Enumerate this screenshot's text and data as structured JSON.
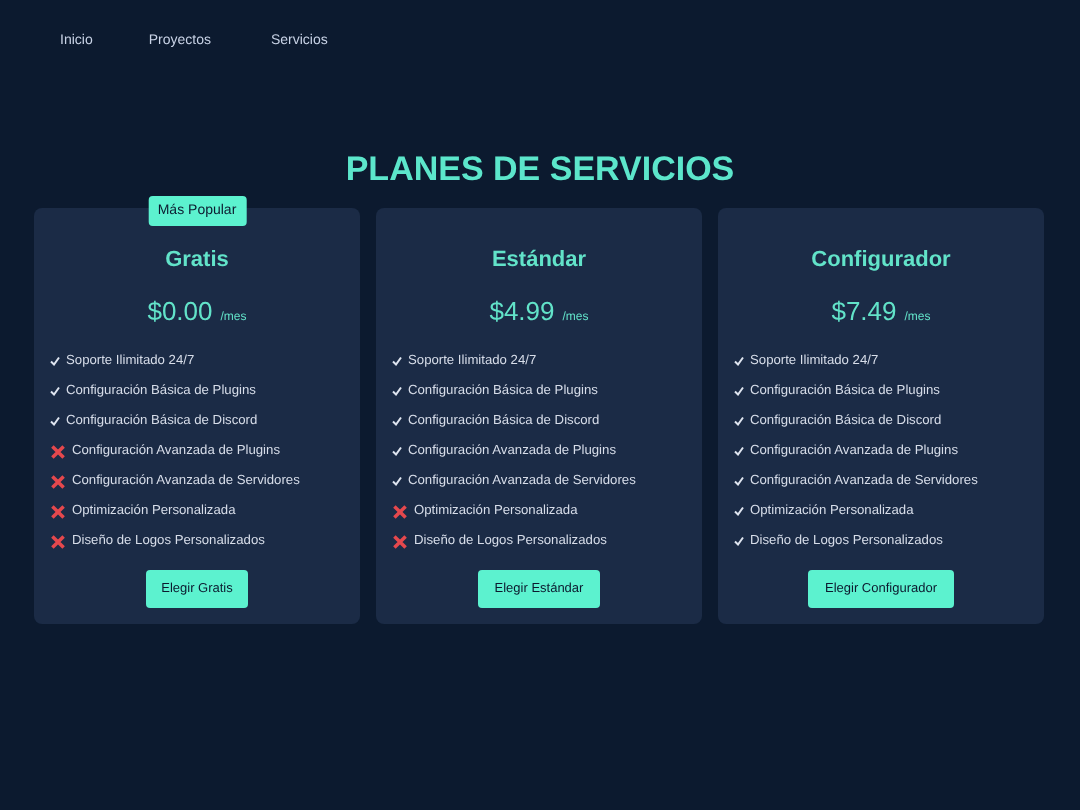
{
  "nav": [
    {
      "label": "Inicio"
    },
    {
      "label": "Proyectos"
    },
    {
      "label": "Servicios"
    }
  ],
  "title": "PLANES DE SERVICIOS",
  "plans": [
    {
      "badge": "Más Popular",
      "name": "Gratis",
      "price": "$0.00",
      "period": "/mes",
      "features": [
        {
          "text": "Soporte Ilimitado 24/7",
          "included": true
        },
        {
          "text": "Configuración Básica de Plugins",
          "included": true
        },
        {
          "text": "Configuración Básica de Discord",
          "included": true
        },
        {
          "text": "Configuración Avanzada de Plugins",
          "included": false
        },
        {
          "text": "Configuración Avanzada de Servidores",
          "included": false
        },
        {
          "text": "Optimización Personalizada",
          "included": false
        },
        {
          "text": "Diseño de Logos Personalizados",
          "included": false
        }
      ],
      "button": "Elegir Gratis"
    },
    {
      "name": "Estándar",
      "price": "$4.99",
      "period": "/mes",
      "features": [
        {
          "text": "Soporte Ilimitado 24/7",
          "included": true
        },
        {
          "text": "Configuración Básica de Plugins",
          "included": true
        },
        {
          "text": "Configuración Básica de Discord",
          "included": true
        },
        {
          "text": "Configuración Avanzada de Plugins",
          "included": true
        },
        {
          "text": "Configuración Avanzada de Servidores",
          "included": true
        },
        {
          "text": "Optimización Personalizada",
          "included": false
        },
        {
          "text": "Diseño de Logos Personalizados",
          "included": false
        }
      ],
      "button": "Elegir Estándar"
    },
    {
      "name": "Configurador",
      "price": "$7.49",
      "period": "/mes",
      "features": [
        {
          "text": "Soporte Ilimitado 24/7",
          "included": true
        },
        {
          "text": "Configuración Básica de Plugins",
          "included": true
        },
        {
          "text": "Configuración Básica de Discord",
          "included": true
        },
        {
          "text": "Configuración Avanzada de Plugins",
          "included": true
        },
        {
          "text": "Configuración Avanzada de Servidores",
          "included": true
        },
        {
          "text": "Optimización Personalizada",
          "included": true
        },
        {
          "text": "Diseño de Logos Personalizados",
          "included": true
        }
      ],
      "button": "Elegir Configurador"
    }
  ]
}
